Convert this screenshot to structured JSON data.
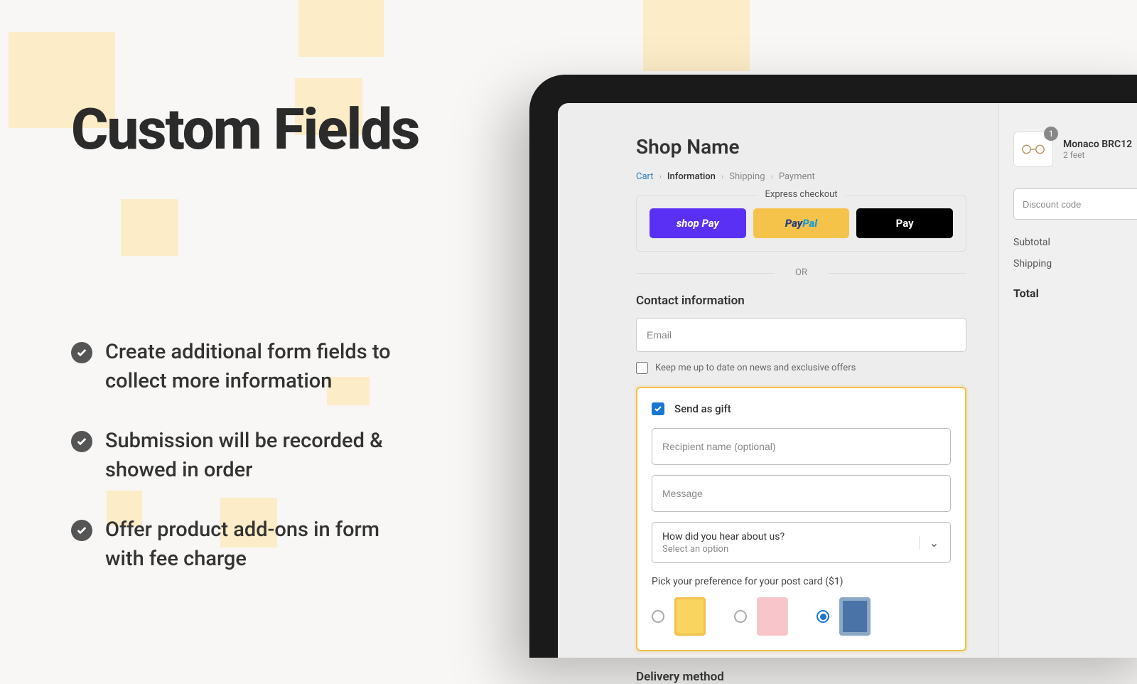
{
  "hero": {
    "title": "Custom Fields"
  },
  "features": [
    "Create additional form fields to collect more information",
    "Submission will be recorded & showed in order",
    "Offer product add-ons in form with fee charge"
  ],
  "checkout": {
    "shop_name": "Shop Name",
    "breadcrumb": {
      "cart": "Cart",
      "information": "Information",
      "shipping": "Shipping",
      "payment": "Payment"
    },
    "express_label": "Express checkout",
    "buttons": {
      "shoppay": "shop Pay",
      "paypal": "PayPal",
      "applepay": " Pay"
    },
    "or": "OR",
    "contact_title": "Contact information",
    "email_placeholder": "Email",
    "news_label": "Keep me up to date on news and exclusive offers",
    "gift": {
      "label": "Send as gift",
      "recipient_placeholder": "Recipient name (optional)",
      "message_placeholder": "Message",
      "select_label": "How did you hear about us?",
      "select_placeholder": "Select an option",
      "postcard_label": "Pick your preference for your post card ($1)"
    },
    "delivery_title": "Delivery method"
  },
  "cart": {
    "item_name": "Monaco BRC12",
    "item_variant": "2 feet",
    "item_qty": "1",
    "discount_placeholder": "Discount code",
    "subtotal_label": "Subtotal",
    "shipping_label": "Shipping",
    "total_label": "Total"
  }
}
